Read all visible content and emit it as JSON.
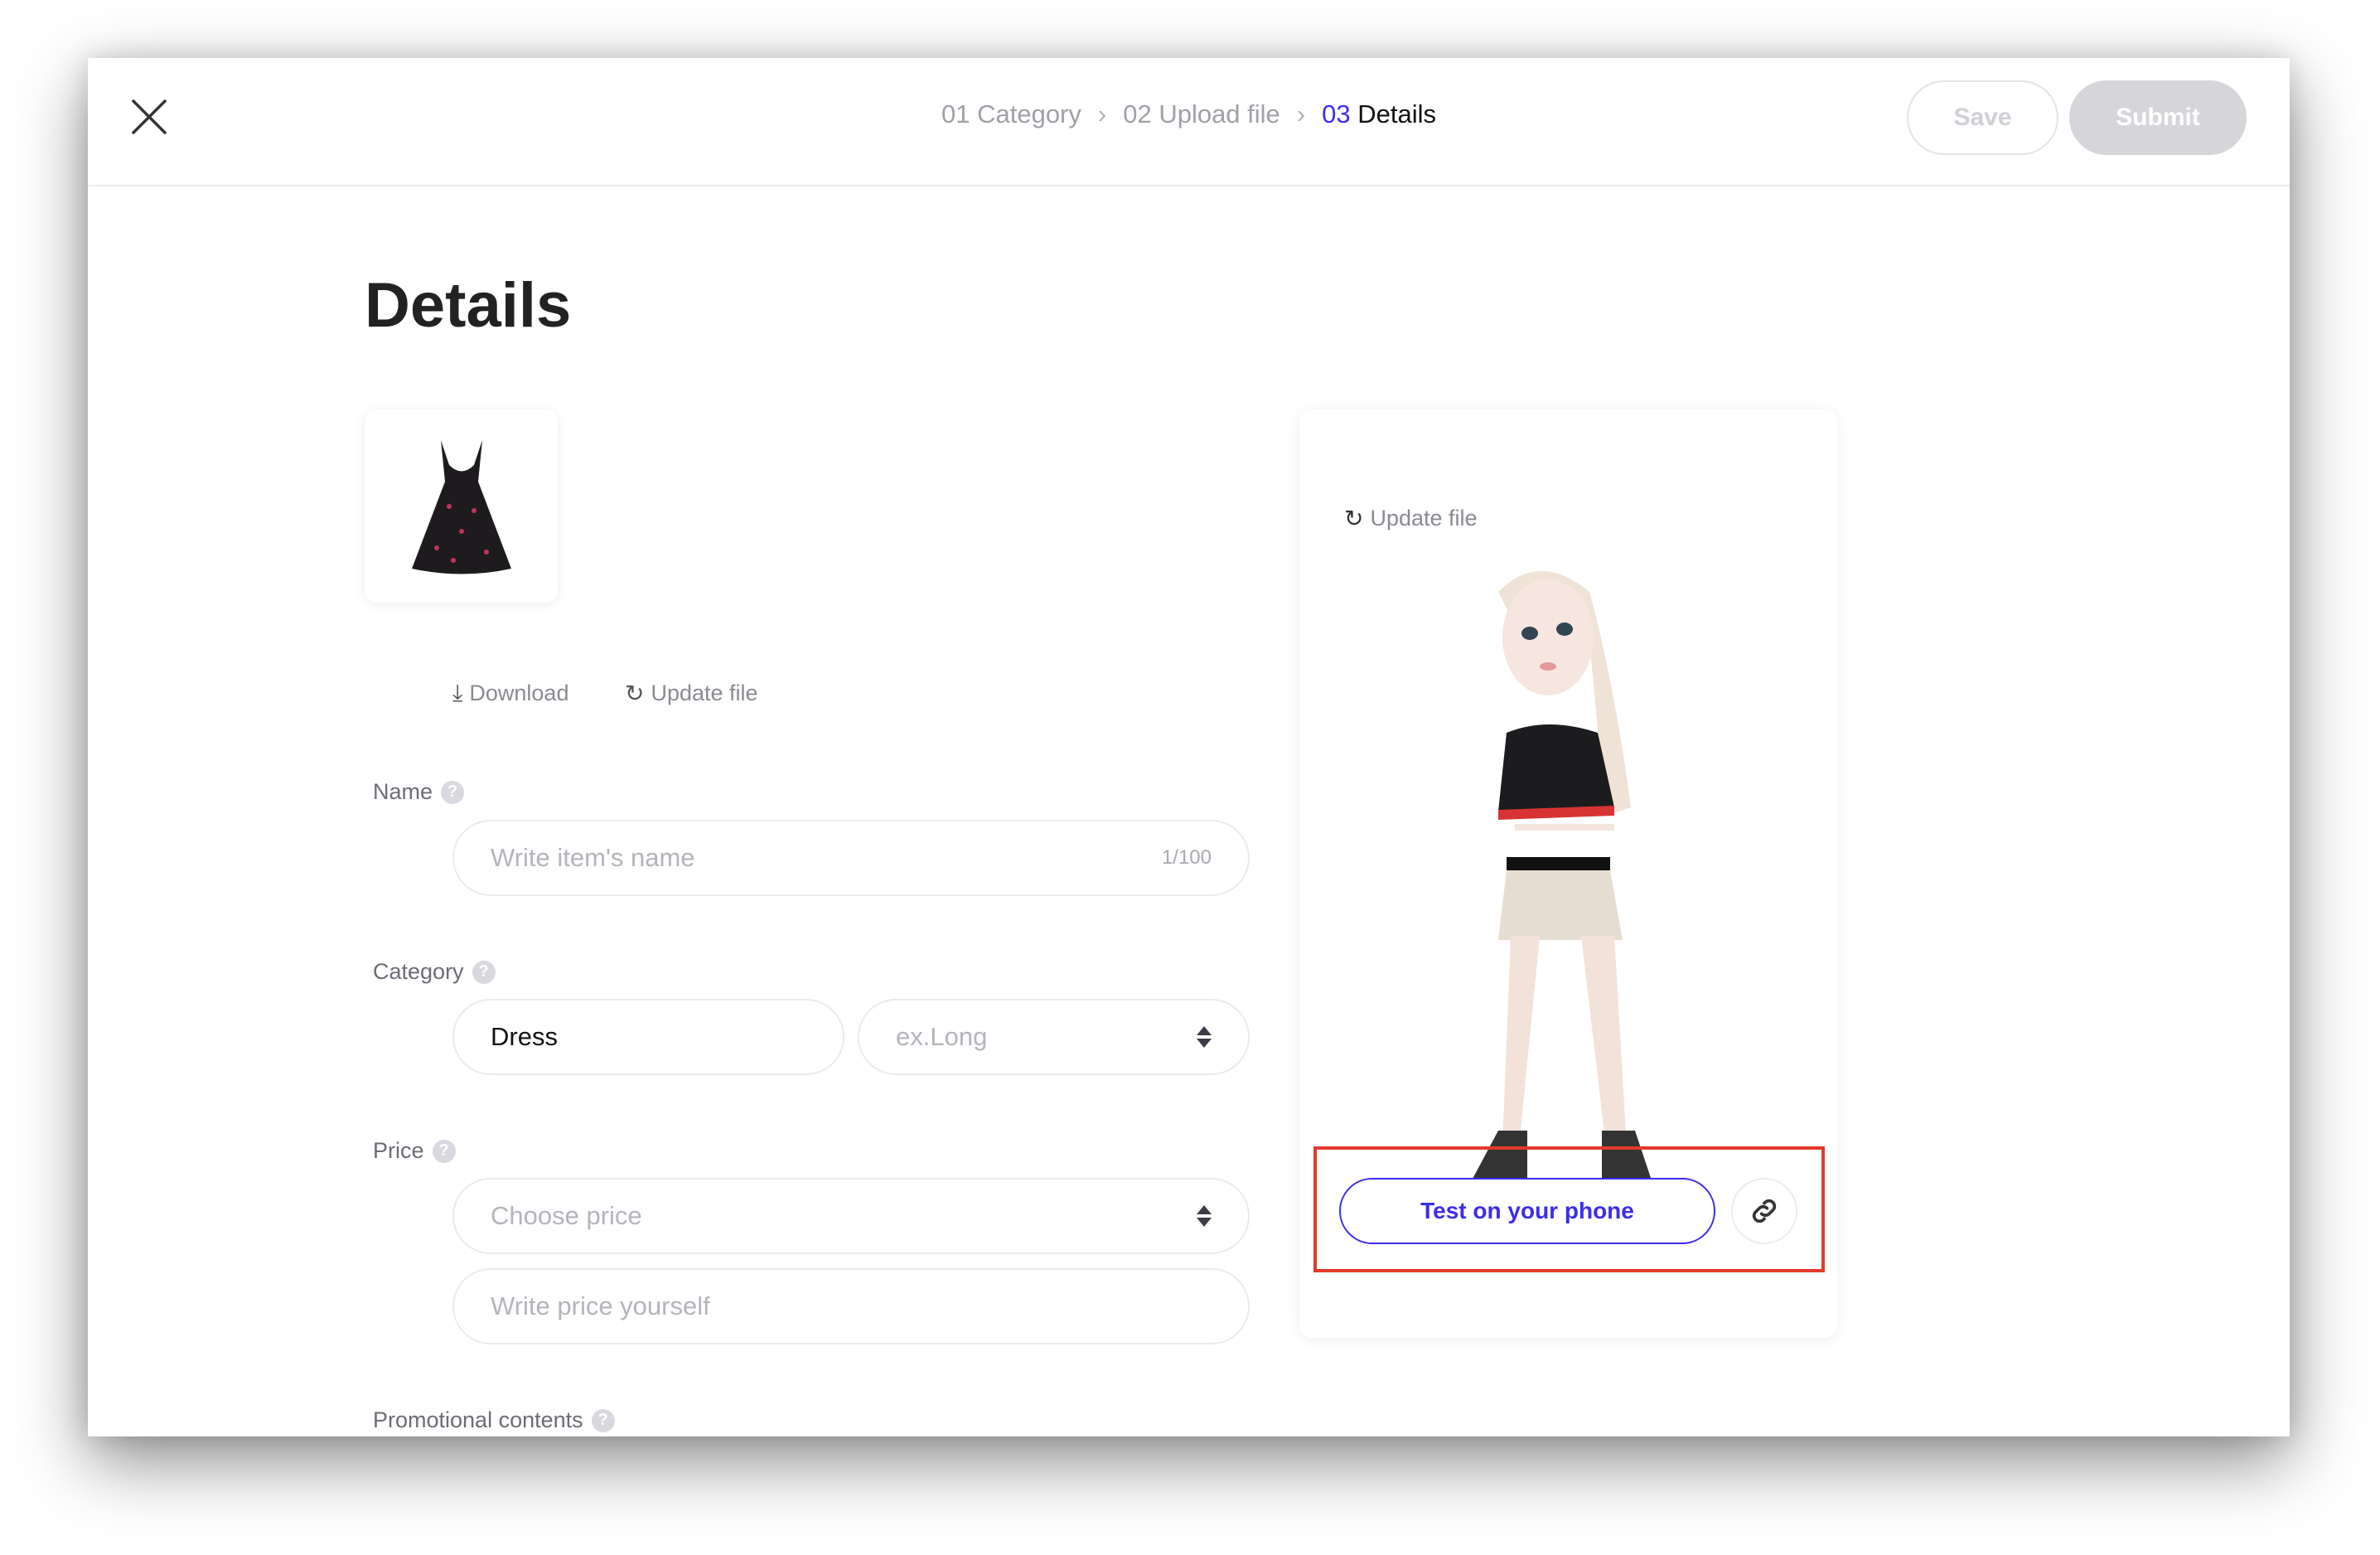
{
  "header": {
    "breadcrumb": [
      {
        "label": "01 Category"
      },
      {
        "label": "02 Upload file"
      },
      {
        "num": "03",
        "label": "Details"
      }
    ],
    "save_label": "Save",
    "submit_label": "Submit"
  },
  "page_title": "Details",
  "file": {
    "download_label": "Download",
    "update_label": "Update file"
  },
  "form": {
    "name": {
      "label": "Name",
      "placeholder": "Write item's name",
      "counter": "1/100"
    },
    "category": {
      "label": "Category",
      "value": "Dress",
      "sub_placeholder": "ex.Long"
    },
    "price": {
      "label": "Price",
      "select_placeholder": "Choose price",
      "input_placeholder": "Write price yourself"
    },
    "promo": {
      "label": "Promotional contents"
    }
  },
  "preview": {
    "update_label": "Update file",
    "test_label": "Test on your phone"
  },
  "colors": {
    "accent": "#3a2df0",
    "highlight": "#e33a2a",
    "disabled": "#d5d5da"
  }
}
